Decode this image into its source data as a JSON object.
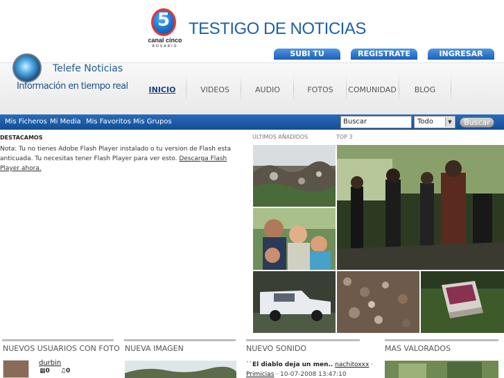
{
  "header": {
    "channel_logo": {
      "number": "5",
      "name": "canal cinco",
      "city": "ROSARIO"
    },
    "site_title": "TESTIGO DE NOTICIAS",
    "buttons": [
      {
        "label": "SUBI TU NOTICIA"
      },
      {
        "label": "REGISTRATE"
      },
      {
        "label": "INGRESAR"
      }
    ]
  },
  "brand": {
    "title": "Telefe Noticias",
    "tagline": "Información en tiempo real"
  },
  "nav": {
    "items": [
      {
        "label": "INICIO",
        "active": true
      },
      {
        "label": "VIDEOS"
      },
      {
        "label": "AUDIO"
      },
      {
        "label": "FOTOS"
      },
      {
        "label": "COMUNIDAD"
      },
      {
        "label": "BLOG"
      }
    ]
  },
  "subnav": {
    "links": [
      {
        "label": "Mis Ficheros"
      },
      {
        "label": "Mi Media"
      },
      {
        "label": "Mis Favoritos"
      },
      {
        "label": "Mis Grupos"
      }
    ],
    "search": {
      "value": "Buscar"
    },
    "filter": {
      "selected": "Todo"
    },
    "search_button": "Buscar"
  },
  "destacados": {
    "title": "DESTACAMOS",
    "note_prefix": "Nota: Tu no tienes Adobe Flash Player instalado o tu version de Flash esta anticuada. Tu necesitas tener Flash Player para ver esto. ",
    "download_link": "Descarga Flash Player ahora."
  },
  "media": {
    "latest_label": "ULTIMOS AÑADIDOS",
    "top_label": "TOP 3"
  },
  "sections": {
    "new_users": {
      "title": "NUEVOS USUARIOS CON FOTO",
      "user": "durbin",
      "stat1": "0",
      "stat2": "0"
    },
    "new_image": {
      "title": "NUEVA IMAGEN"
    },
    "new_sound": {
      "title": "NUEVO SONIDO",
      "item_title": "El diablo deja un men..",
      "item_author": "nachitoxxx",
      "item_category": "Primicias",
      "item_date": "10-07-2008 13:47:10"
    },
    "top_rated": {
      "title": "MAS VALORADOS"
    }
  },
  "colors": {
    "brand_blue": "#1e5fa8",
    "bar_blue": "#134e95",
    "button_blue": "#2f7ad0"
  }
}
